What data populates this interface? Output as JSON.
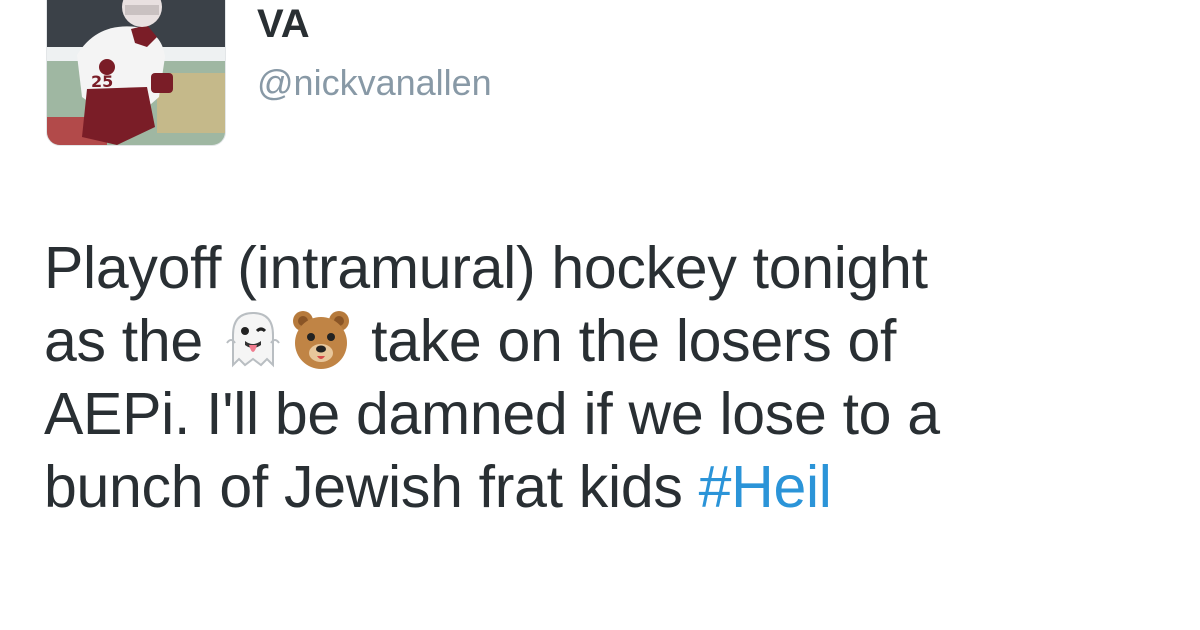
{
  "user": {
    "display_name": "VA",
    "handle": "@nickvanallen",
    "avatar_icon": "hockey-player-avatar"
  },
  "tweet": {
    "line1": "Playoff (intramural) hockey tonight",
    "line2_before": "as the",
    "line2_after": "take on the losers of",
    "emojis": [
      "ghost-tongue-emoji",
      "bear-face-emoji"
    ],
    "line3": "AEPi. I'll be damned if we lose to a",
    "line4_text": "bunch of Jewish frat kids",
    "hashtag": "#Heil"
  },
  "colors": {
    "text": "#292f33",
    "handle": "#8899a6",
    "hashtag": "#2b94d8",
    "background": "#ffffff"
  }
}
